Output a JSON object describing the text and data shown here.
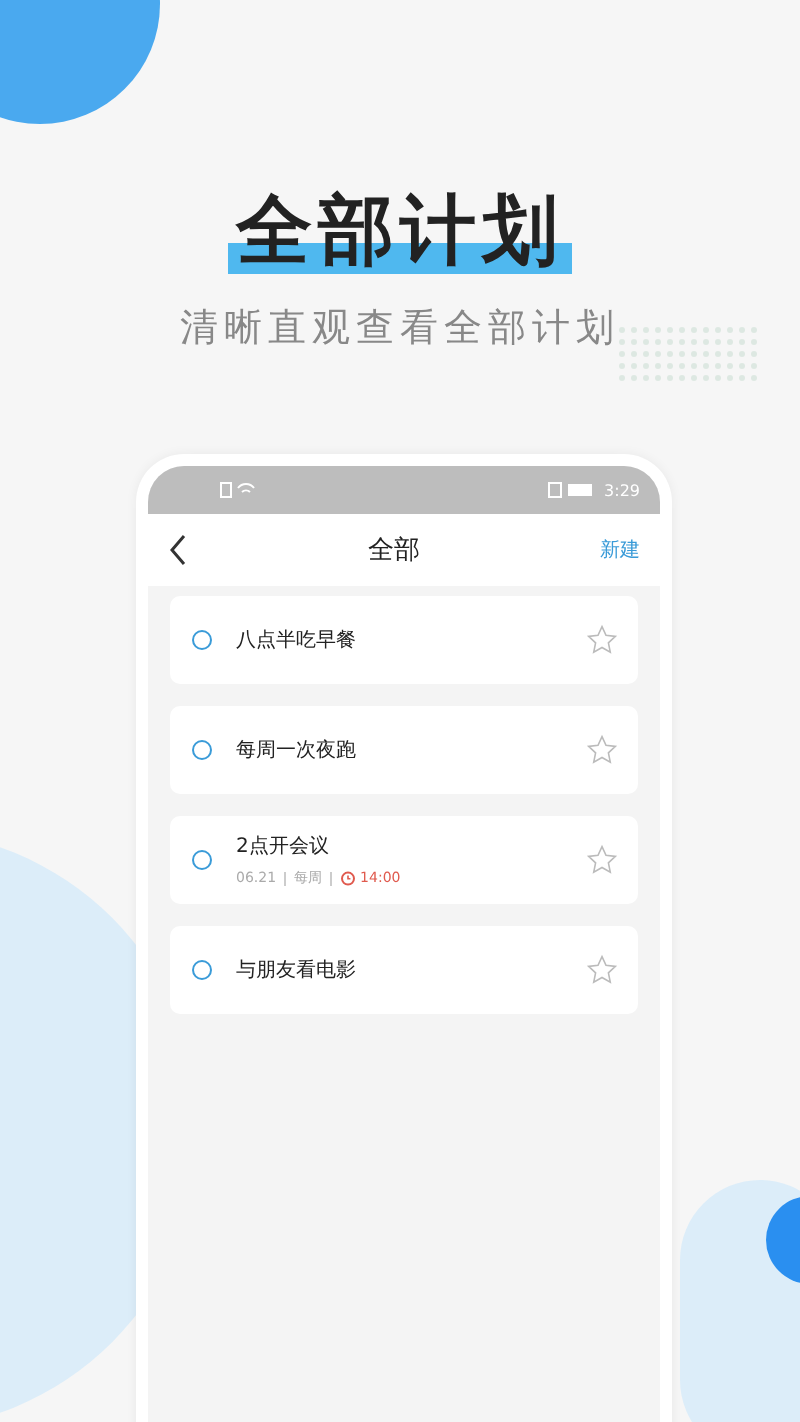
{
  "headline": "全部计划",
  "subtitle": "清晰直观查看全部计划",
  "status_bar": {
    "time": "3:29"
  },
  "nav": {
    "title": "全部",
    "action": "新建"
  },
  "tasks": [
    {
      "title": "八点半吃早餐",
      "done": false,
      "starred": false
    },
    {
      "title": "每周一次夜跑",
      "done": false,
      "starred": false
    },
    {
      "title": "2点开会议",
      "done": false,
      "starred": false,
      "date": "06.21",
      "repeat": "每周",
      "alarm": "14:00"
    },
    {
      "title": "与朋友看电影",
      "done": false,
      "starred": false
    }
  ]
}
